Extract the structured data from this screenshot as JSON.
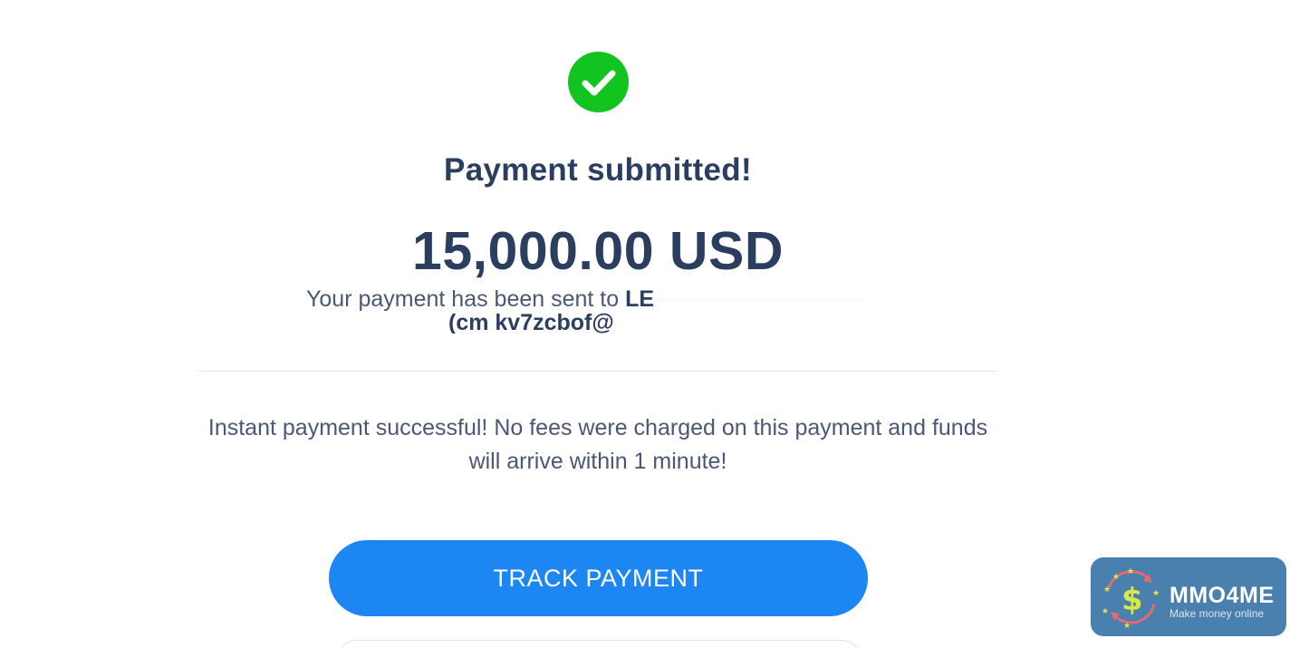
{
  "status": {
    "icon": "check-circle-icon",
    "title": "Payment submitted!",
    "color": "#12c41f"
  },
  "payment": {
    "amount": "15,000.00 USD",
    "sent_prefix": "Your payment has been sent to",
    "recipient_name_visible": "LE",
    "recipient_email_visible": "(cm kv7zcbof@"
  },
  "info": {
    "message": "Instant payment successful! No fees were charged on this payment and funds will arrive within 1 minute!"
  },
  "actions": {
    "track_label": "TRACK PAYMENT",
    "accent": "#1c86f2"
  },
  "watermark": {
    "name": "MMO4ME",
    "tagline": "Make money online",
    "icon": "dollar-stars-icon"
  }
}
